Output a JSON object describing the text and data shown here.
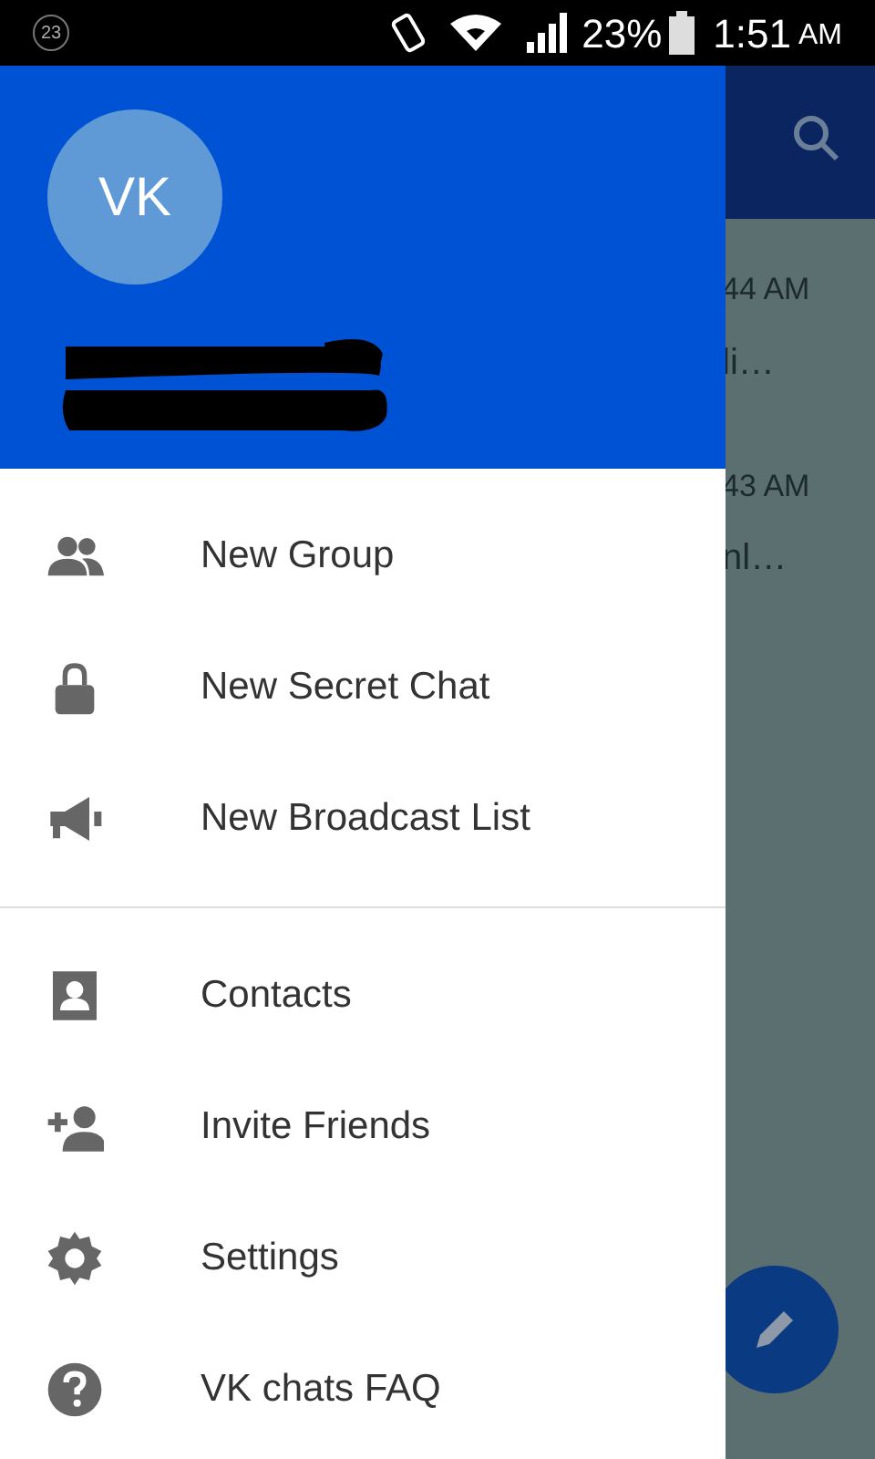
{
  "status_bar": {
    "notification_count": "23",
    "battery": "23%",
    "time": "1:51",
    "meridiem": "AM"
  },
  "drawer": {
    "avatar_initials": "VK",
    "sections": [
      [
        {
          "label": "New Group"
        },
        {
          "label": "New Secret Chat"
        },
        {
          "label": "New Broadcast List"
        }
      ],
      [
        {
          "label": "Contacts"
        },
        {
          "label": "Invite Friends"
        },
        {
          "label": "Settings"
        },
        {
          "label": "VK chats FAQ"
        }
      ]
    ]
  },
  "chat_list_behind": [
    {
      "time": "44 AM",
      "preview": "li…"
    },
    {
      "time": "43 AM",
      "preview": "nl…"
    }
  ]
}
